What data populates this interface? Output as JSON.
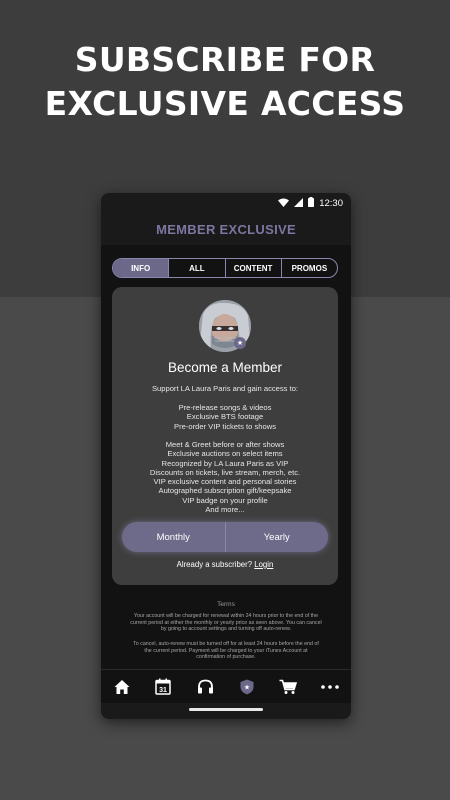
{
  "promo": {
    "line1": "SUBSCRIBE FOR",
    "line2": "EXCLUSIVE ACCESS"
  },
  "status_bar": {
    "time": "12:30",
    "icons": [
      "wifi-icon",
      "signal-icon",
      "battery-icon"
    ]
  },
  "header": {
    "title": "MEMBER EXCLUSIVE"
  },
  "tabs": [
    {
      "label": "INFO",
      "active": true
    },
    {
      "label": "ALL",
      "active": false
    },
    {
      "label": "CONTENT",
      "active": false
    },
    {
      "label": "PROMOS",
      "active": false
    }
  ],
  "card": {
    "title": "Become a Member",
    "intro": "Support LA Laura Paris and gain access to:",
    "benefits_1": [
      "Pre-release songs & videos",
      "Exclusive BTS footage",
      "Pre-order VIP tickets to shows"
    ],
    "benefits_2": [
      "Meet & Greet before or after shows",
      "Exclusive auctions on select items",
      "Recognized by LA Laura Paris as VIP",
      "Discounts on tickets, live stream, merch, etc.",
      "VIP exclusive content and personal stories",
      "Autographed subscription gift/keepsake",
      "VIP badge on your profile",
      "And more..."
    ],
    "plans": {
      "monthly": "Monthly",
      "yearly": "Yearly"
    },
    "subscriber_prompt": "Already a subscriber?",
    "login_label": "Login"
  },
  "terms": {
    "title": "Terms",
    "paragraph_1": [
      "Your account will be charged for renewal within 24 hours prior to the end of the",
      "current period at either the monthly or yearly price as seen above. You can cancel",
      "by going to account settings and turning off auto-renew."
    ],
    "paragraph_2": [
      "To cancel, auto-renew must be turned off for at least 24 hours before the end of",
      "the current period. Payment will be charged to your iTunes Account at",
      "confirmation of purchase."
    ]
  },
  "bottom_nav": {
    "items": [
      "home-icon",
      "calendar-icon",
      "headphones-icon",
      "member-badge-icon",
      "cart-icon",
      "more-icon"
    ],
    "calendar_day": "31"
  },
  "colors": {
    "accent": "#6c6889",
    "header_text": "#7c76a0"
  }
}
